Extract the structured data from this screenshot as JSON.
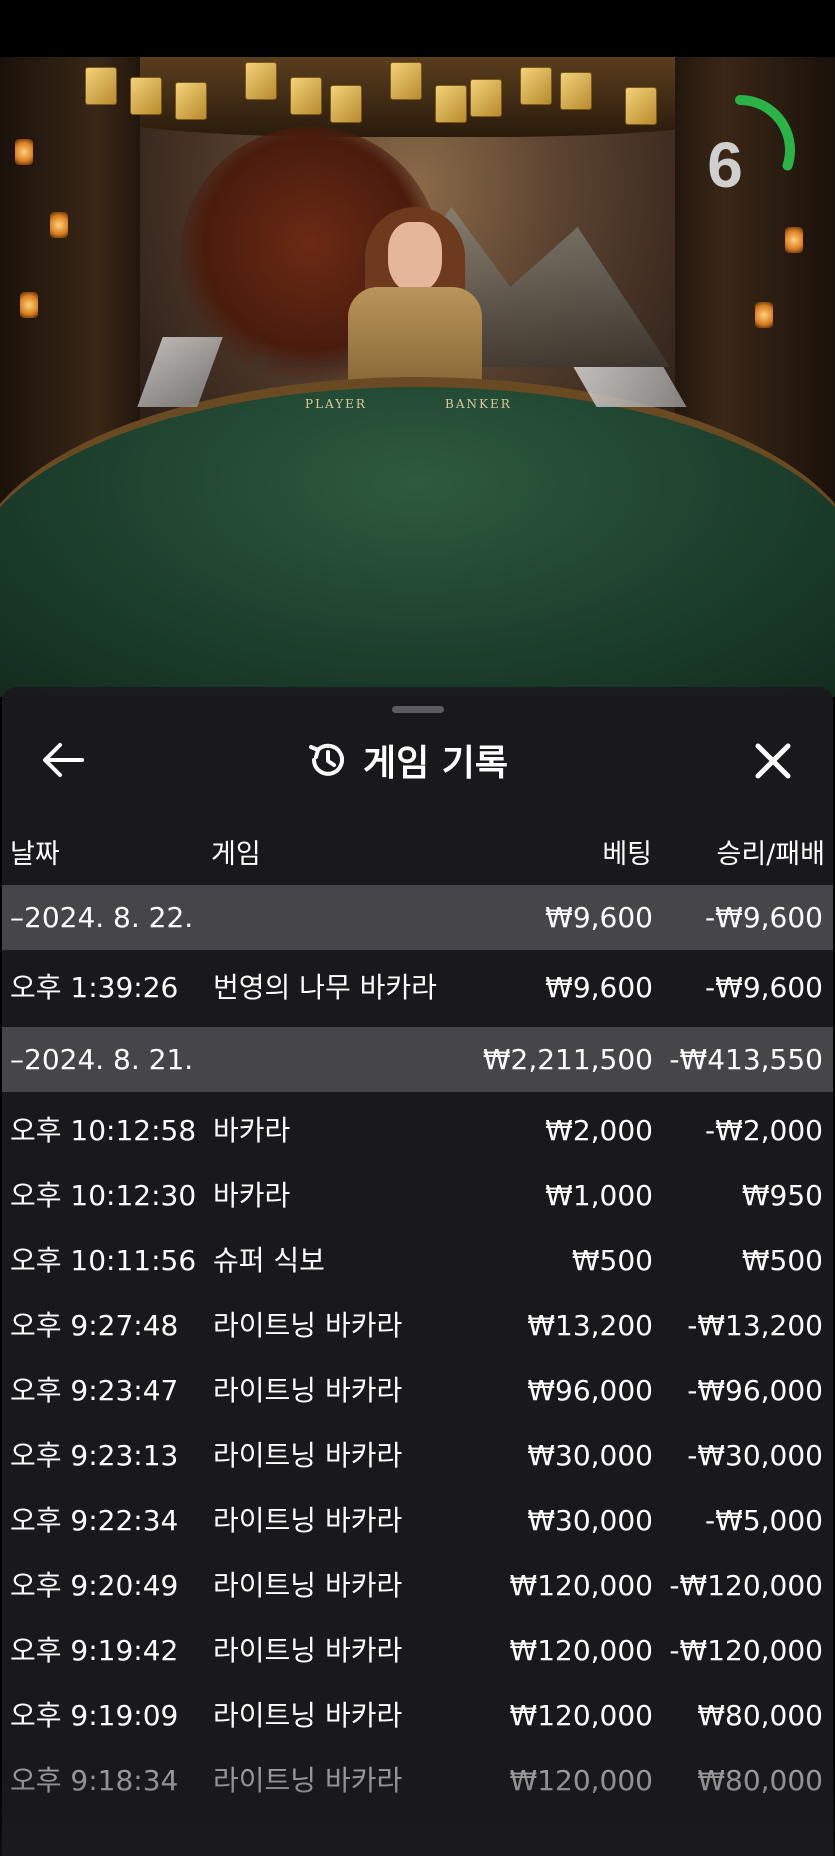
{
  "video": {
    "table_labels": {
      "player": "PLAYER",
      "banker": "BANKER"
    },
    "timer": {
      "value": "6",
      "fraction_remaining": 0.3,
      "color": "#2bb34a"
    }
  },
  "panel": {
    "title": "게임 기록",
    "icons": {
      "back": "arrow-left-icon",
      "history": "history-icon",
      "close": "close-icon"
    },
    "columns": {
      "date": "날짜",
      "game": "게임",
      "bet": "베팅",
      "win_loss": "승리/패배"
    },
    "rows": [
      {
        "type": "date",
        "date": "–2024. 8. 22.",
        "game": "",
        "bet": "₩9,600",
        "win_loss": "-₩9,600"
      },
      {
        "type": "entry",
        "date": "오후 1:39:26",
        "game": "번영의 나무 바카라",
        "bet": "₩9,600",
        "win_loss": "-₩9,600"
      },
      {
        "type": "date",
        "date": "–2024. 8. 21.",
        "game": "",
        "bet": "₩2,211,500",
        "win_loss": "-₩413,550"
      },
      {
        "type": "entry",
        "date": "오후 10:12:58",
        "game": "바카라",
        "bet": "₩2,000",
        "win_loss": "-₩2,000"
      },
      {
        "type": "entry",
        "date": "오후 10:12:30",
        "game": "바카라",
        "bet": "₩1,000",
        "win_loss": "₩950"
      },
      {
        "type": "entry",
        "date": "오후 10:11:56",
        "game": "슈퍼 식보",
        "bet": "₩500",
        "win_loss": "₩500"
      },
      {
        "type": "entry",
        "date": "오후 9:27:48",
        "game": "라이트닝 바카라",
        "bet": "₩13,200",
        "win_loss": "-₩13,200"
      },
      {
        "type": "entry",
        "date": "오후 9:23:47",
        "game": "라이트닝 바카라",
        "bet": "₩96,000",
        "win_loss": "-₩96,000"
      },
      {
        "type": "entry",
        "date": "오후 9:23:13",
        "game": "라이트닝 바카라",
        "bet": "₩30,000",
        "win_loss": "-₩30,000"
      },
      {
        "type": "entry",
        "date": "오후 9:22:34",
        "game": "라이트닝 바카라",
        "bet": "₩30,000",
        "win_loss": "-₩5,000"
      },
      {
        "type": "entry",
        "date": "오후 9:20:49",
        "game": "라이트닝 바카라",
        "bet": "₩120,000",
        "win_loss": "-₩120,000"
      },
      {
        "type": "entry",
        "date": "오후 9:19:42",
        "game": "라이트닝 바카라",
        "bet": "₩120,000",
        "win_loss": "-₩120,000"
      },
      {
        "type": "entry",
        "date": "오후 9:19:09",
        "game": "라이트닝 바카라",
        "bet": "₩120,000",
        "win_loss": "₩80,000"
      },
      {
        "type": "entry",
        "date": "오후 9:18:34",
        "game": "라이트닝 바카라",
        "bet": "₩120,000",
        "win_loss": "₩80,000"
      }
    ]
  }
}
